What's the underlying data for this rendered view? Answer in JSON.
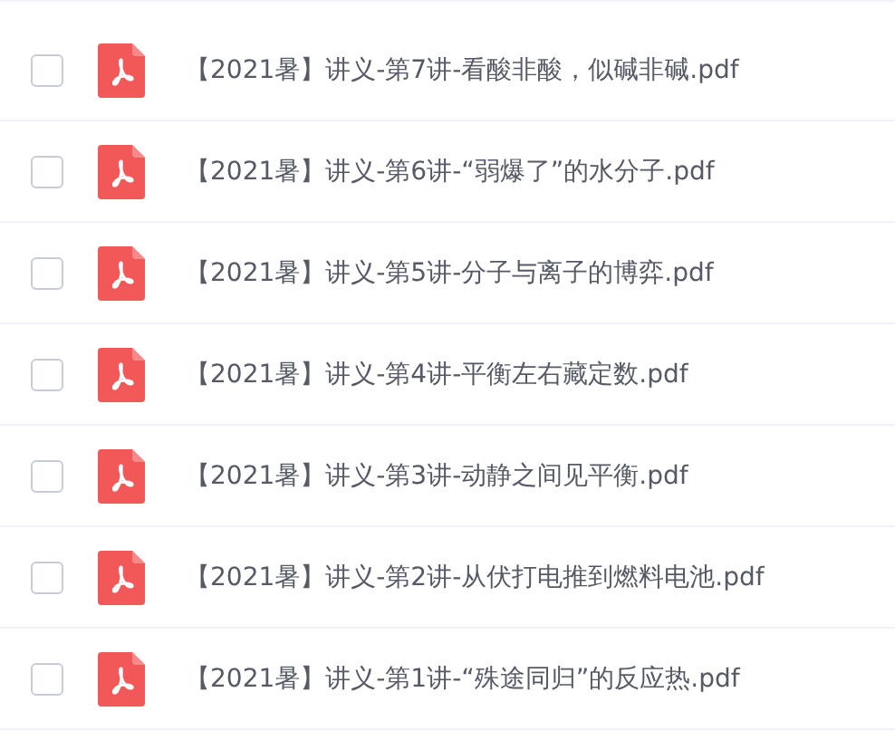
{
  "files": [
    {
      "name": "【2021暑】讲义-第7讲-看酸非酸，似碱非碱.pdf",
      "checked": false
    },
    {
      "name": "【2021暑】讲义-第6讲-“弱爆了”的水分子.pdf",
      "checked": false
    },
    {
      "name": "【2021暑】讲义-第5讲-分子与离子的博弈.pdf",
      "checked": false
    },
    {
      "name": "【2021暑】讲义-第4讲-平衡左右藏定数.pdf",
      "checked": false
    },
    {
      "name": "【2021暑】讲义-第3讲-动静之间见平衡.pdf",
      "checked": false
    },
    {
      "name": "【2021暑】讲义-第2讲-从伏打电推到燃料电池.pdf",
      "checked": false
    },
    {
      "name": "【2021暑】讲义-第1讲-“殊途同归”的反应热.pdf",
      "checked": false
    }
  ]
}
